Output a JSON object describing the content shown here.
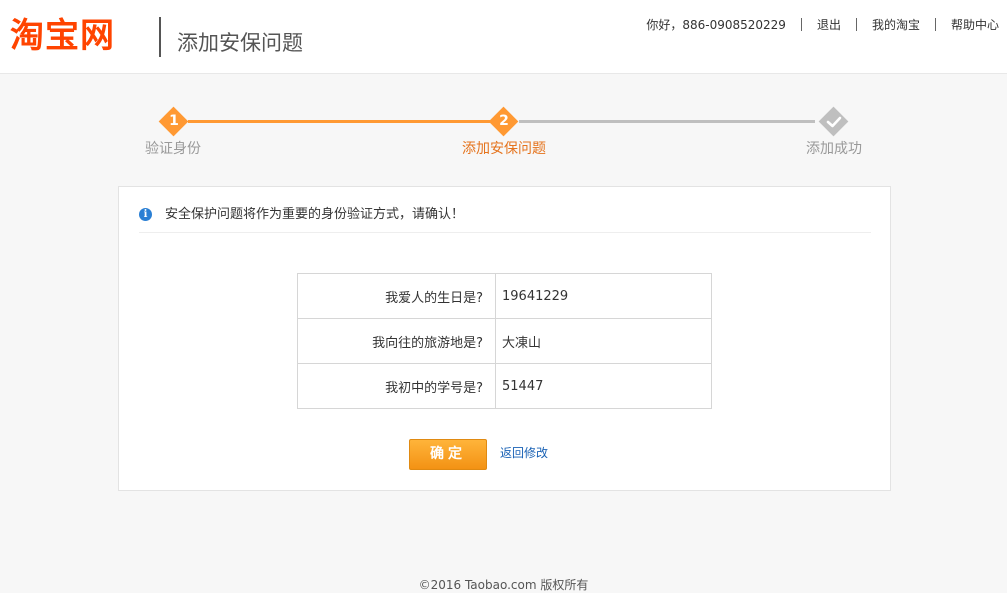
{
  "header": {
    "logo": "淘宝网",
    "title": "添加安保问题",
    "nav": {
      "greeting": "你好，886-0908520229",
      "logout": "退出",
      "my_taobao": "我的淘宝",
      "help": "帮助中心"
    }
  },
  "steps": [
    {
      "number": "1",
      "label": "验证身份",
      "state": "done"
    },
    {
      "number": "2",
      "label": "添加安保问题",
      "state": "current"
    },
    {
      "number": "",
      "label": "添加成功",
      "state": "pending"
    }
  ],
  "colors": {
    "accent": "#ff9933",
    "step_active_text": "#e5731c",
    "step_pending": "#bfbfbf",
    "logo": "#ff4400",
    "link": "#1a62b5"
  },
  "notice": {
    "icon": "info-icon",
    "text": "安全保护问题将作为重要的身份验证方式，请确认！"
  },
  "questions": [
    {
      "question": "我爱人的生日是?",
      "answer": "19641229"
    },
    {
      "question": "我向往的旅游地是?",
      "answer": "大凍山"
    },
    {
      "question": "我初中的学号是?",
      "answer": "51447"
    }
  ],
  "actions": {
    "confirm": "确定",
    "back": "返回修改"
  },
  "footer": "©2016 Taobao.com 版权所有"
}
